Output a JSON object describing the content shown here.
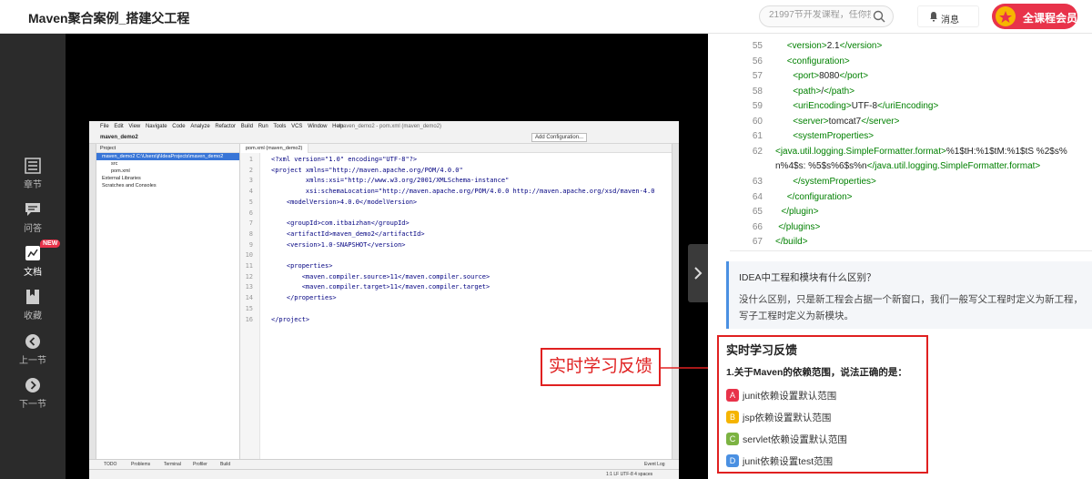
{
  "header": {
    "title": "Maven聚合案例_搭建父工程",
    "search_placeholder": "21997节开发课程，任你搜",
    "messages_label": "消息",
    "vip_label": "全课程会员"
  },
  "leftnav": {
    "items": [
      {
        "label": "章节",
        "icon": "chapter-list-icon"
      },
      {
        "label": "问答",
        "icon": "qa-chat-icon"
      },
      {
        "label": "文档",
        "icon": "document-chart-icon",
        "badge": "NEW"
      },
      {
        "label": "收藏",
        "icon": "bookmark-icon"
      },
      {
        "label": "上一节",
        "icon": "prev-arrow-icon"
      },
      {
        "label": "下一节",
        "icon": "next-arrow-icon"
      }
    ]
  },
  "ide": {
    "menu": [
      "File",
      "Edit",
      "View",
      "Navigate",
      "Code",
      "Analyze",
      "Refactor",
      "Build",
      "Run",
      "Tools",
      "VCS",
      "Window",
      "Help"
    ],
    "window_title": "maven_demo2 - pom.xml (maven_demo2)",
    "project_name": "maven_demo2",
    "add_config_label": "Add Configuration...",
    "project_panel_title": "Project",
    "tree": [
      {
        "label": "maven_demo2  C:\\Users\\ji\\IdeaProjects\\maven_demo2",
        "selected": true
      },
      {
        "label": "src",
        "selected": false
      },
      {
        "label": "pom.xml",
        "selected": false
      },
      {
        "label": "External Libraries",
        "selected": false
      },
      {
        "label": "Scratches and Consoles",
        "selected": false
      }
    ],
    "tab": "pom.xml (maven_demo2)",
    "code": [
      {
        "n": "1",
        "t": "<?xml version=\"1.0\" encoding=\"UTF-8\"?>"
      },
      {
        "n": "2",
        "t": "<project xmlns=\"http://maven.apache.org/POM/4.0.0\""
      },
      {
        "n": "3",
        "t": "         xmlns:xsi=\"http://www.w3.org/2001/XMLSchema-instance\""
      },
      {
        "n": "4",
        "t": "         xsi:schemaLocation=\"http://maven.apache.org/POM/4.0.0 http://maven.apache.org/xsd/maven-4.0"
      },
      {
        "n": "5",
        "t": "    <modelVersion>4.0.0</modelVersion>"
      },
      {
        "n": "6",
        "t": ""
      },
      {
        "n": "7",
        "t": "    <groupId>com.itbaizhan</groupId>"
      },
      {
        "n": "8",
        "t": "    <artifactId>maven_demo2</artifactId>"
      },
      {
        "n": "9",
        "t": "    <version>1.0-SNAPSHOT</version>"
      },
      {
        "n": "10",
        "t": ""
      },
      {
        "n": "11",
        "t": "    <properties>"
      },
      {
        "n": "12",
        "t": "        <maven.compiler.source>11</maven.compiler.source>"
      },
      {
        "n": "13",
        "t": "        <maven.compiler.target>11</maven.compiler.target>"
      },
      {
        "n": "14",
        "t": "    </properties>"
      },
      {
        "n": "15",
        "t": ""
      },
      {
        "n": "16",
        "t": "</project>"
      }
    ],
    "bottom_tools": [
      "TODO",
      "Problems",
      "Terminal",
      "Profiler",
      "Build"
    ],
    "event_log": "Event Log",
    "status": "1:1   LF   UTF-8   4 spaces"
  },
  "annotation": {
    "label": "实时学习反馈"
  },
  "doc": {
    "code": [
      {
        "n": "55",
        "pre": "    ",
        "a": "<version>",
        "v": "2.1",
        "b": "</version>"
      },
      {
        "n": "56",
        "pre": "    ",
        "a": "<configuration>",
        "v": "",
        "b": ""
      },
      {
        "n": "57",
        "pre": "      ",
        "a": "<port>",
        "v": "8080",
        "b": "</port>"
      },
      {
        "n": "58",
        "pre": "      ",
        "a": "<path>",
        "v": "/",
        "b": "</path>"
      },
      {
        "n": "59",
        "pre": "      ",
        "a": "<uriEncoding>",
        "v": "UTF-8",
        "b": "</uriEncoding>"
      },
      {
        "n": "60",
        "pre": "      ",
        "a": "<server>",
        "v": "tomcat7",
        "b": "</server>"
      },
      {
        "n": "61",
        "pre": "      ",
        "a": "<systemProperties>",
        "v": "",
        "b": ""
      }
    ],
    "line62_num": "62",
    "line62_a": "<java.util.logging.SimpleFormatter.format>",
    "line62_v1": "%1$tH:%1$tM:%1$tS %2$s%",
    "line62_v2": "n%4$s: %5$s%6$s%n",
    "line62_b": "</java.util.logging.SimpleFormatter.format>",
    "code_after": [
      {
        "n": "63",
        "pre": "      ",
        "a": "</systemProperties>"
      },
      {
        "n": "64",
        "pre": "    ",
        "a": "</configuration>"
      },
      {
        "n": "65",
        "pre": "  ",
        "a": "</plugin>"
      },
      {
        "n": "66",
        "pre": " ",
        "a": "</plugins>"
      },
      {
        "n": "67",
        "pre": "",
        "a": "</build>"
      }
    ],
    "qa_question": "IDEA中工程和模块有什么区别？",
    "qa_answer": "没什么区别，只是新工程会占据一个新窗口，我们一般写父工程时定义为新工程，写子工程时定义为新模块。"
  },
  "quiz": {
    "title": "实时学习反馈",
    "question": "1.关于Maven的依赖范围，说法正确的是：",
    "options": [
      {
        "key": "A",
        "text": "junit依赖设置默认范围",
        "color": "#e8334a"
      },
      {
        "key": "B",
        "text": "jsp依赖设置默认范围",
        "color": "#f5b400"
      },
      {
        "key": "C",
        "text": "servlet依赖设置默认范围",
        "color": "#7cb342"
      },
      {
        "key": "D",
        "text": "junit依赖设置test范围",
        "color": "#4a90e2"
      }
    ]
  }
}
